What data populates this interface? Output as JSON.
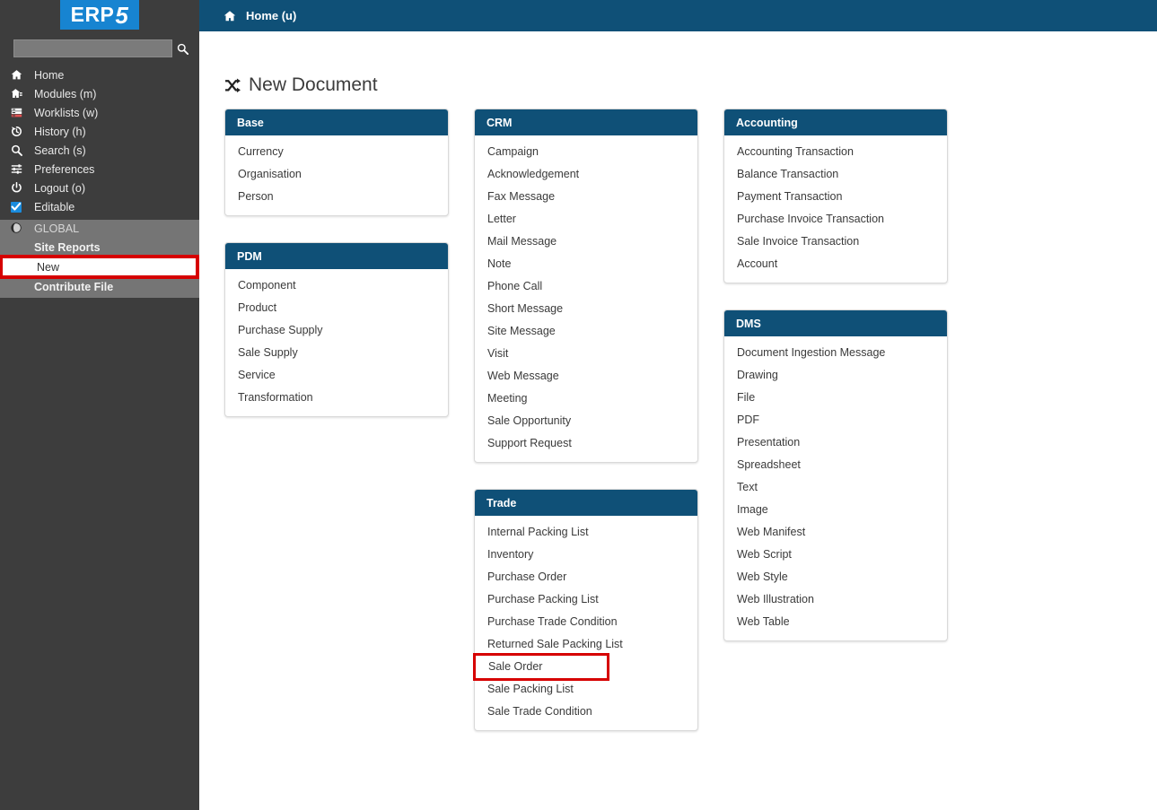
{
  "app": {
    "logo_text": "ERP",
    "logo_accent": "5",
    "brand_color": "#1784d1",
    "header_color": "#0f5077",
    "highlight_color": "#d60000"
  },
  "sidebar": {
    "search": {
      "value": "",
      "placeholder": "",
      "icon": "search-icon"
    },
    "items": [
      {
        "label": "Home",
        "icon": "home-icon"
      },
      {
        "label": "Modules (m)",
        "icon": "modules-icon"
      },
      {
        "label": "Worklists (w)",
        "icon": "worklists-icon"
      },
      {
        "label": "History (h)",
        "icon": "history-icon"
      },
      {
        "label": "Search (s)",
        "icon": "search-icon"
      },
      {
        "label": "Preferences",
        "icon": "sliders-icon"
      },
      {
        "label": "Logout (o)",
        "icon": "power-icon"
      },
      {
        "label": "Editable",
        "icon": "checkbox-checked-icon"
      }
    ],
    "global": {
      "label": "GLOBAL",
      "icon": "globe-icon",
      "items": [
        {
          "label": "Site Reports",
          "highlighted": false
        },
        {
          "label": "New",
          "highlighted": true
        },
        {
          "label": "Contribute File",
          "highlighted": false
        }
      ]
    }
  },
  "topbar": {
    "breadcrumb": "Home (u)",
    "icon": "home-icon"
  },
  "main": {
    "title": "New Document",
    "title_icon": "shuffle-icon",
    "panels": [
      {
        "title": "Base",
        "items": [
          {
            "label": "Currency"
          },
          {
            "label": "Organisation"
          },
          {
            "label": "Person"
          }
        ]
      },
      {
        "title": "CRM",
        "items": [
          {
            "label": "Campaign"
          },
          {
            "label": "Acknowledgement"
          },
          {
            "label": "Fax Message"
          },
          {
            "label": "Letter"
          },
          {
            "label": "Mail Message"
          },
          {
            "label": "Note"
          },
          {
            "label": "Phone Call"
          },
          {
            "label": "Short Message"
          },
          {
            "label": "Site Message"
          },
          {
            "label": "Visit"
          },
          {
            "label": "Web Message"
          },
          {
            "label": "Meeting"
          },
          {
            "label": "Sale Opportunity"
          },
          {
            "label": "Support Request"
          }
        ]
      },
      {
        "title": "Accounting",
        "items": [
          {
            "label": "Accounting Transaction"
          },
          {
            "label": "Balance Transaction"
          },
          {
            "label": "Payment Transaction"
          },
          {
            "label": "Purchase Invoice Transaction"
          },
          {
            "label": "Sale Invoice Transaction"
          },
          {
            "label": "Account"
          }
        ]
      },
      {
        "title": "PDM",
        "items": [
          {
            "label": "Component"
          },
          {
            "label": "Product"
          },
          {
            "label": "Purchase Supply"
          },
          {
            "label": "Sale Supply"
          },
          {
            "label": "Service"
          },
          {
            "label": "Transformation"
          }
        ]
      },
      {
        "title": "Trade",
        "items": [
          {
            "label": "Internal Packing List"
          },
          {
            "label": "Inventory"
          },
          {
            "label": "Purchase Order"
          },
          {
            "label": "Purchase Packing List"
          },
          {
            "label": "Purchase Trade Condition"
          },
          {
            "label": "Returned Sale Packing List"
          },
          {
            "label": "Sale Order",
            "highlighted": true
          },
          {
            "label": "Sale Packing List"
          },
          {
            "label": "Sale Trade Condition"
          }
        ]
      },
      {
        "title": "DMS",
        "items": [
          {
            "label": "Document Ingestion Message"
          },
          {
            "label": "Drawing"
          },
          {
            "label": "File"
          },
          {
            "label": "PDF"
          },
          {
            "label": "Presentation"
          },
          {
            "label": "Spreadsheet"
          },
          {
            "label": "Text"
          },
          {
            "label": "Image"
          },
          {
            "label": "Web Manifest"
          },
          {
            "label": "Web Script"
          },
          {
            "label": "Web Style"
          },
          {
            "label": "Web Illustration"
          },
          {
            "label": "Web Table"
          }
        ]
      }
    ]
  }
}
